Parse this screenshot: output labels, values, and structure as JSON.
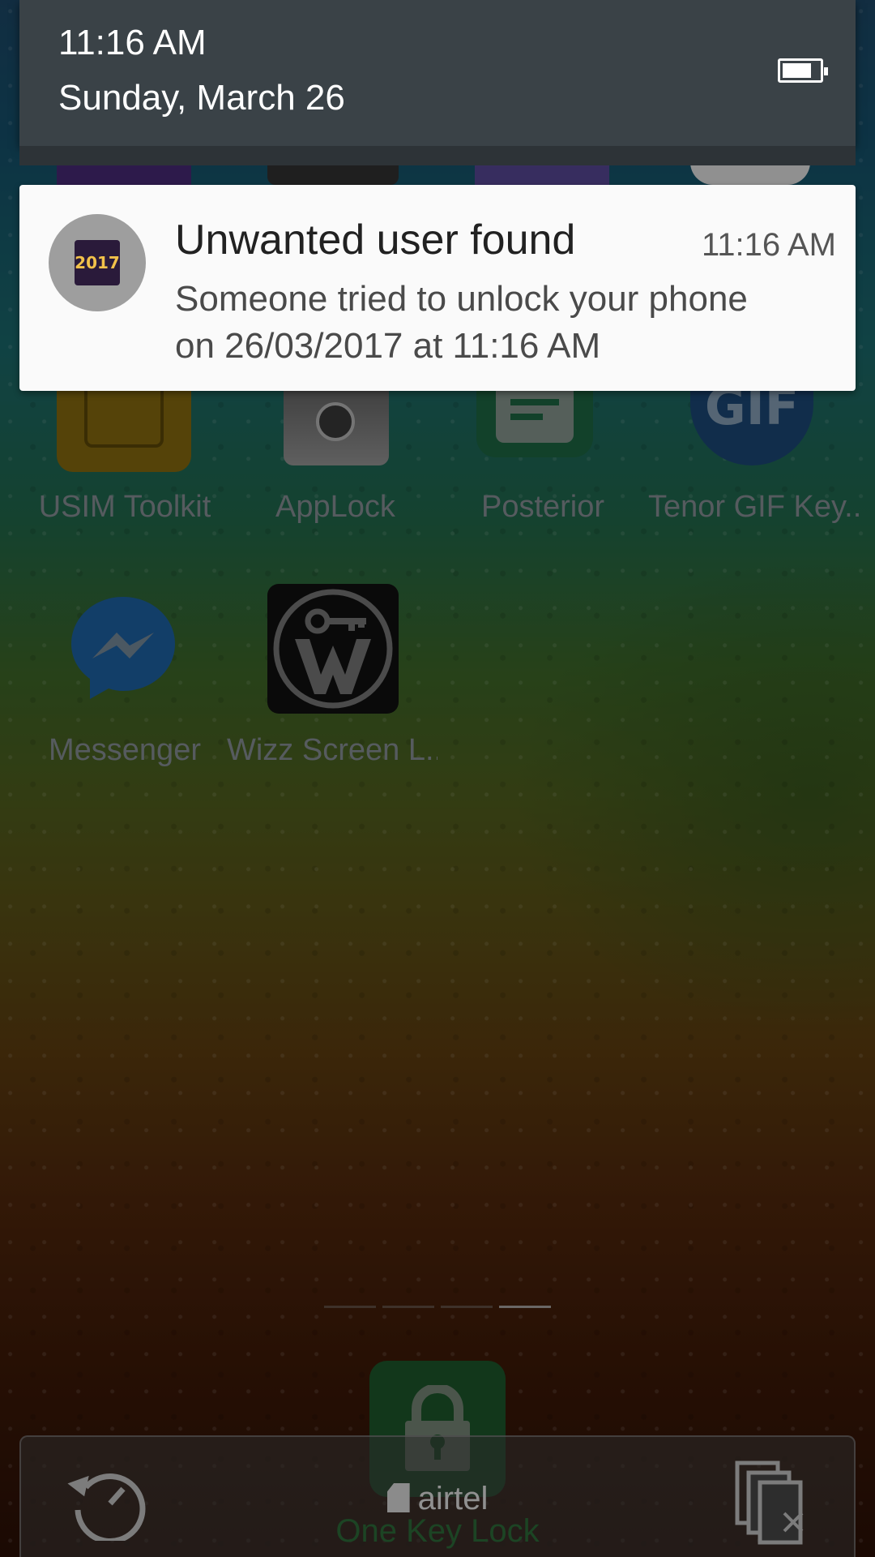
{
  "status": {
    "time": "11:16 AM",
    "date": "Sunday, March 26",
    "battery_level": 0.8
  },
  "notification": {
    "app_icon": "2017-new-year-icon",
    "icon_text": "2017",
    "title": "Unwanted user found",
    "time": "11:16 AM",
    "body": "Someone tried to unlock your phone\non  26/03/2017  at 11:16  AM"
  },
  "apps": [
    {
      "label": "USIM Toolkit",
      "icon": "sim-chip-icon"
    },
    {
      "label": "AppLock",
      "icon": "safe-icon"
    },
    {
      "label": "Posterior",
      "icon": "message-doc-icon"
    },
    {
      "label": "Tenor GIF Key..",
      "icon": "gif-icon",
      "icon_text": "GIF"
    },
    {
      "label": "Messenger",
      "icon": "messenger-icon"
    },
    {
      "label": "Wizz Screen L..",
      "icon": "wizz-key-icon"
    }
  ],
  "pager": {
    "pages": 4,
    "current": 4
  },
  "dock": {
    "carrier": "airtel",
    "lock_label": "One Key Lock"
  },
  "colors": {
    "header_bg": "#3a4247",
    "card_bg": "#fafafa",
    "label_gray": "#8b939a",
    "lock_green": "#1e5a2c"
  }
}
